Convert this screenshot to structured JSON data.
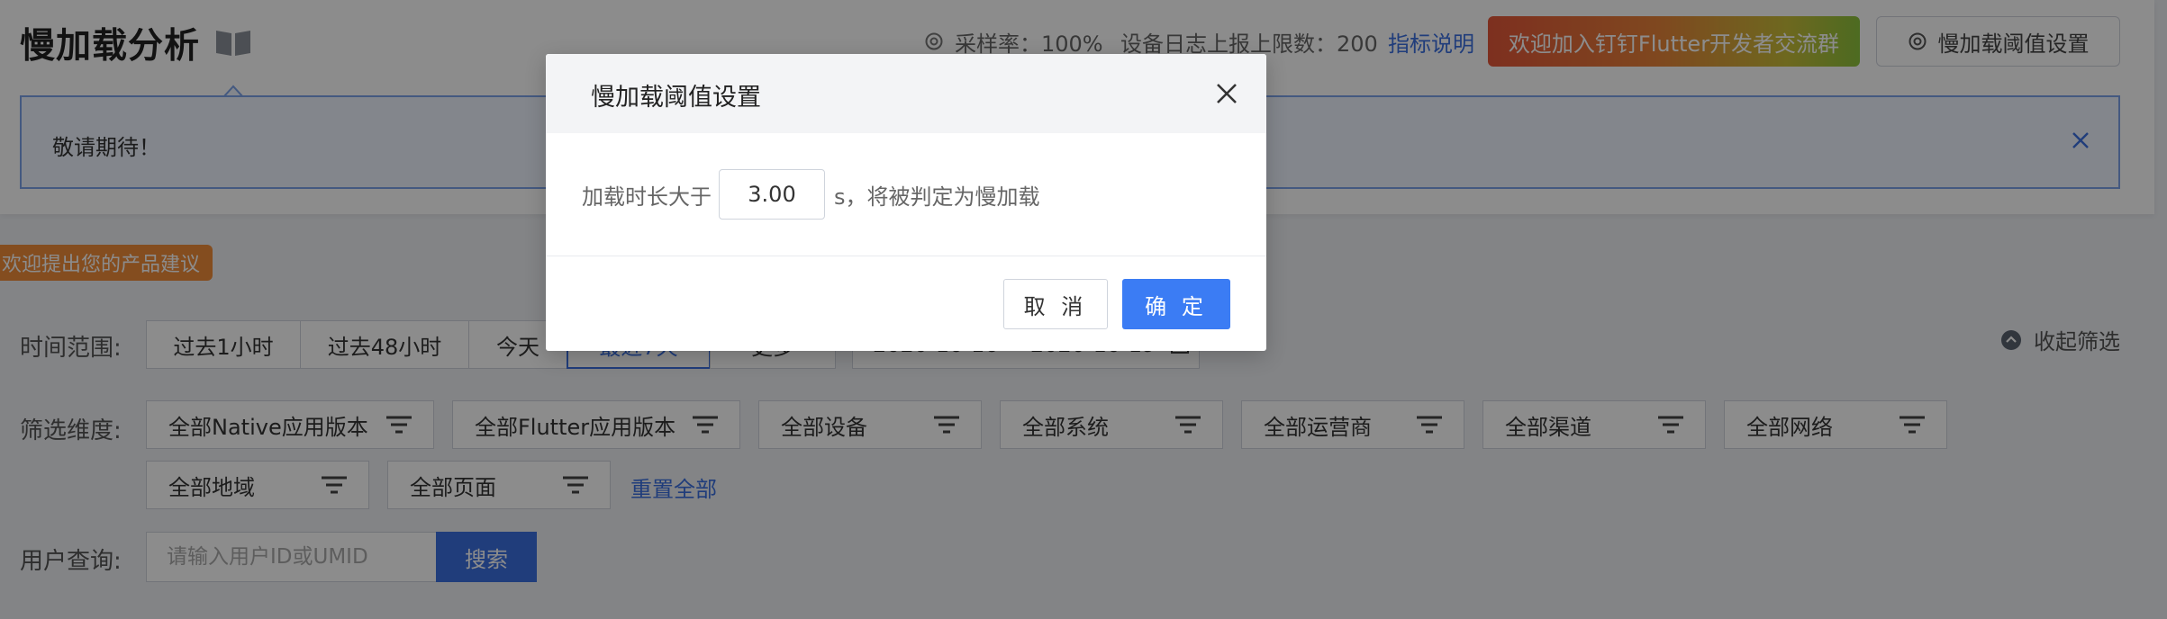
{
  "header": {
    "title": "慢加载分析",
    "sample_rate_label": "采样率：100%",
    "log_limit_label": "设备日志上报上限数：200",
    "metric_link": "指标说明",
    "join_group_button": "欢迎加入钉钉Flutter开发者交流群",
    "threshold_button": "慢加载阈值设置"
  },
  "notice": {
    "text": "敬请期待！"
  },
  "suggest_tag": "欢迎提出您的产品建议",
  "filters": {
    "time_label": "时间范围:",
    "time_options": [
      "过去1小时",
      "过去48小时",
      "今天",
      "最近7天",
      "更多"
    ],
    "date_range": "2020-10-16 ~ 2020-10-19",
    "collapse_label": "收起筛选",
    "dimension_label": "筛选维度:",
    "dimensions": [
      "全部Native应用版本",
      "全部Flutter应用版本",
      "全部设备",
      "全部系统",
      "全部运营商",
      "全部渠道",
      "全部网络",
      "全部地域",
      "全部页面"
    ],
    "reset_label": "重置全部",
    "user_label": "用户查询:",
    "user_placeholder": "请输入用户ID或UMID",
    "search_button": "搜索"
  },
  "modal": {
    "title": "慢加载阈值设置",
    "prefix": "加载时长大于",
    "value": "3.00",
    "suffix": "s，将被判定为慢加载",
    "cancel": "取 消",
    "confirm": "确 定"
  },
  "colors": {
    "primary": "#3b6fe0",
    "confirm": "#3b7cf4",
    "tag": "#f08c3a",
    "mask": "rgba(0,0,0,0.45)"
  }
}
